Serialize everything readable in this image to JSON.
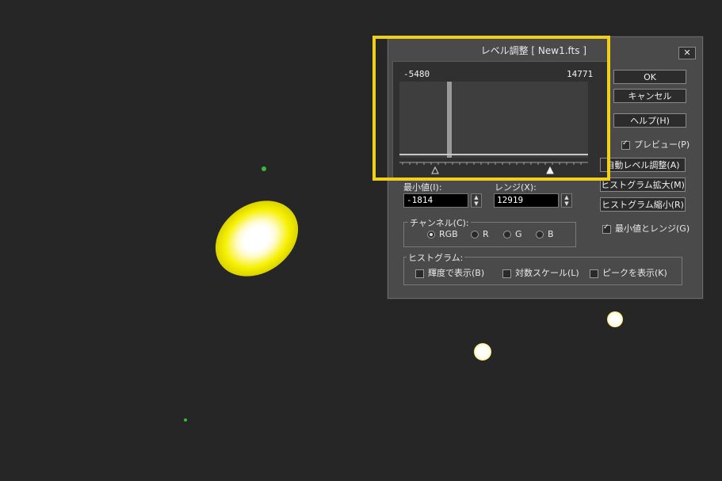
{
  "dialog": {
    "title": "レベル調整 [ New1.fts ]",
    "close_label": "✕",
    "histogram_min_value": "-5480",
    "histogram_max_value": "14771",
    "buttons": {
      "ok": "OK",
      "cancel": "キャンセル",
      "help": "ヘルプ(H)",
      "auto_level": "自動レベル調整(A)",
      "hist_zoom_in": "ヒストグラム拡大(M)",
      "hist_zoom_out": "ヒストグラム縮小(R)"
    },
    "preview": {
      "label": "プレビュー(P)",
      "checked": true
    },
    "min_and_range": {
      "label": "最小値とレンジ(G)",
      "checked": true
    },
    "min_field": {
      "label": "最小値(I):",
      "value": "-1814"
    },
    "range_field": {
      "label": "レンジ(X):",
      "value": "12919"
    },
    "channel": {
      "label": "チャンネル(C):",
      "options": [
        "RGB",
        "R",
        "G",
        "B"
      ],
      "selected": "RGB"
    },
    "histogram_group": {
      "label": "ヒストグラム:",
      "options": [
        {
          "label": "輝度で表示(B)",
          "checked": false
        },
        {
          "label": "対数スケール(L)",
          "checked": false
        },
        {
          "label": "ピークを表示(K)",
          "checked": false
        }
      ]
    }
  },
  "colors": {
    "background": "#262626",
    "dialog": "#4a4a4a",
    "highlight": "#f2cf1a"
  }
}
